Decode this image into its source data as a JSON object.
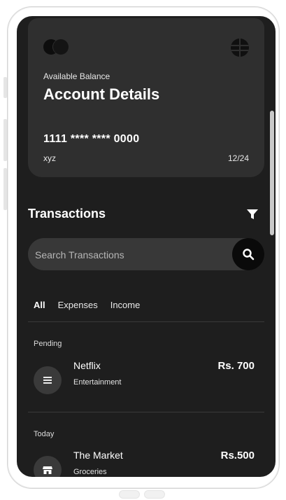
{
  "card": {
    "label": "Available Balance",
    "title": "Account Details",
    "number": "1111 **** **** 0000",
    "holder": "xyz",
    "expiry": "12/24"
  },
  "transactions": {
    "title": "Transactions",
    "search_placeholder": "Search Transactions",
    "tabs": [
      "All",
      "Expenses",
      "Income"
    ],
    "active_tab": "All",
    "sections": [
      {
        "label": "Pending",
        "items": [
          {
            "name": "Netflix",
            "category": "Entertainment",
            "amount": "Rs. 700",
            "icon": "menu-icon"
          }
        ]
      },
      {
        "label": "Today",
        "items": [
          {
            "name": "The Market",
            "category": "Groceries",
            "amount": "Rs.500",
            "icon": "store-icon"
          }
        ]
      }
    ]
  },
  "colors": {
    "screen_bg": "#1e1e1e",
    "card_bg": "#2f2f2f",
    "search_bg": "#383838",
    "accent": "#ffffff"
  }
}
